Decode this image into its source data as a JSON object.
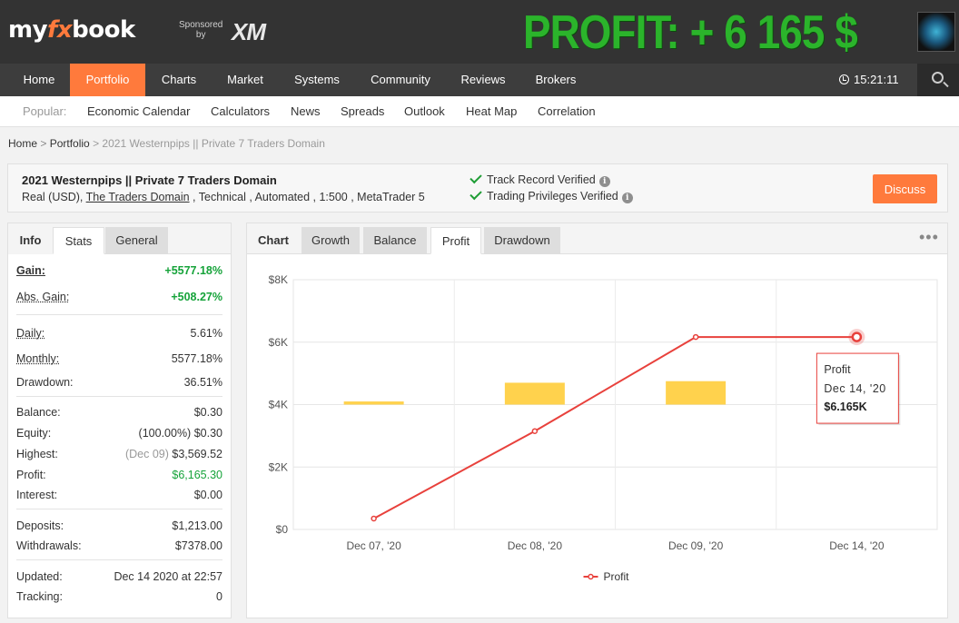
{
  "header": {
    "logo_my": "my",
    "logo_fx": "fx",
    "logo_book": "book",
    "sponsored_line1": "Sponsored",
    "sponsored_line2": "by",
    "sponsor_name": "XM",
    "banner": "PROFIT: + 6 165 $",
    "avatar_icon": "user-avatar-icon"
  },
  "nav": {
    "items": [
      "Home",
      "Portfolio",
      "Charts",
      "Market",
      "Systems",
      "Community",
      "Reviews",
      "Brokers"
    ],
    "active": "Portfolio",
    "time": "15:21:11",
    "accent": "#ff7a3c"
  },
  "subnav": {
    "popular_label": "Popular:",
    "items": [
      "Economic Calendar",
      "Calculators",
      "News",
      "Spreads",
      "Outlook",
      "Heat Map",
      "Correlation"
    ]
  },
  "breadcrumb": {
    "home": "Home",
    "portfolio": "Portfolio",
    "current": "2021 Westernpips || Private 7 Traders Domain"
  },
  "account": {
    "title": "2021 Westernpips || Private 7 Traders Domain",
    "sub_pre": "Real (USD), ",
    "broker_link": "The Traders Domain",
    "sub_post": " , Technical , Automated , 1:500 , MetaTrader 5",
    "verified_track": "Track Record Verified",
    "verified_trading": "Trading Privileges Verified",
    "discuss_label": "Discuss"
  },
  "left_tabs": [
    "Info",
    "Stats",
    "General"
  ],
  "stats": {
    "gain": {
      "label": "Gain:",
      "value": "+5577.18%"
    },
    "abs_gain": {
      "label": "Abs. Gain:",
      "value": "+508.27%"
    },
    "daily": {
      "label": "Daily:",
      "value": "5.61%"
    },
    "monthly": {
      "label": "Monthly:",
      "value": "5577.18%"
    },
    "drawdown": {
      "label": "Drawdown:",
      "value": "36.51%"
    },
    "balance": {
      "label": "Balance:",
      "value": "$0.30"
    },
    "equity": {
      "label": "Equity:",
      "value_pct": "(100.00%)",
      "value": "$0.30"
    },
    "highest": {
      "label": "Highest:",
      "value_date": "(Dec 09)",
      "value": "$3,569.52"
    },
    "profit": {
      "label": "Profit:",
      "value": "$6,165.30"
    },
    "interest": {
      "label": "Interest:",
      "value": "$0.00"
    },
    "deposits": {
      "label": "Deposits:",
      "value": "$1,213.00"
    },
    "withdrawals": {
      "label": "Withdrawals:",
      "value": "$7378.00"
    },
    "updated": {
      "label": "Updated:",
      "value": "Dec 14 2020 at 22:57"
    },
    "tracking": {
      "label": "Tracking:",
      "value": "0"
    }
  },
  "chart_tabs": [
    "Chart",
    "Growth",
    "Balance",
    "Profit",
    "Drawdown"
  ],
  "chart_active_tab": "Profit",
  "chart_data": {
    "type": "line",
    "categories": [
      "Dec 07, '20",
      "Dec 08, '20",
      "Dec 09, '20",
      "Dec 14, '20"
    ],
    "series": [
      {
        "name": "Profit",
        "type": "line",
        "color": "#e8413c",
        "values": [
          350,
          3150,
          6165,
          6165
        ]
      },
      {
        "type": "floating-bar",
        "color": "#ffd24d",
        "values": [
          [
            4000,
            4100
          ],
          [
            4000,
            4700
          ],
          [
            4000,
            4750
          ],
          null
        ]
      }
    ],
    "yticks": [
      "$0",
      "$2K",
      "$4K",
      "$6K",
      "$8K"
    ],
    "ylim": [
      0,
      8000
    ],
    "legend": "bottom-center",
    "grid": true,
    "tooltip": {
      "title": "Profit",
      "date": "Dec 14, '20",
      "value": "$6.165K"
    }
  }
}
